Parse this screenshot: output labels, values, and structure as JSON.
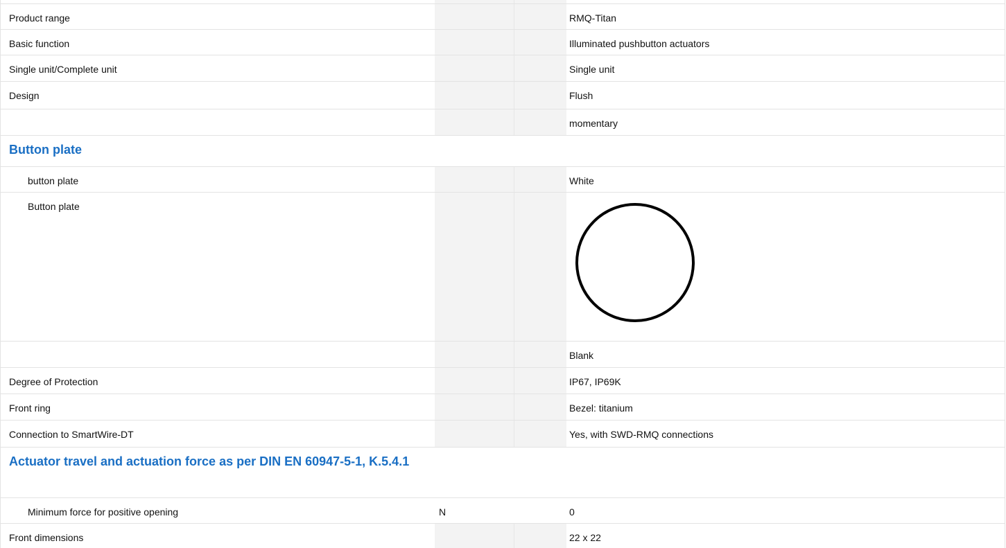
{
  "rows": {
    "product_range": {
      "label": "Product range",
      "unit": "",
      "value": "RMQ-Titan"
    },
    "basic_function": {
      "label": "Basic function",
      "unit": "",
      "value": "Illuminated pushbutton actuators"
    },
    "single_unit": {
      "label": "Single unit/Complete unit",
      "unit": "",
      "value": "Single unit"
    },
    "design": {
      "label": "Design",
      "unit": "",
      "value": "Flush"
    },
    "design_extra": {
      "label": "",
      "unit": "",
      "value": "momentary"
    },
    "button_plate_section": {
      "label": "Button plate"
    },
    "button_plate_color": {
      "label": "button plate",
      "unit": "",
      "value": "White"
    },
    "button_plate_symbol": {
      "label": "Button plate",
      "unit": "",
      "value_icon": "blank-circle-icon"
    },
    "button_plate_blank": {
      "label": "",
      "unit": "",
      "value": "Blank"
    },
    "degree_of_protection": {
      "label": "Degree of Protection",
      "unit": "",
      "value": "IP67, IP69K"
    },
    "front_ring": {
      "label": "Front ring",
      "unit": "",
      "value": "Bezel: titanium"
    },
    "smartwire": {
      "label": "Connection to SmartWire-DT",
      "unit": "",
      "value": "Yes, with SWD-RMQ connections"
    },
    "actuator_section": {
      "label": "Actuator travel and actuation force as per DIN EN 60947-5-1, K.5.4.1"
    },
    "min_force": {
      "label": "Minimum force for positive opening",
      "unit": "N",
      "value": "0"
    },
    "front_dimensions": {
      "label": "Front dimensions",
      "unit": "",
      "value": "22 x 22"
    }
  },
  "colors": {
    "section_heading": "#1a6fc4",
    "unit_column_shade": "#f3f3f3",
    "row_border": "#e3e3e3"
  }
}
